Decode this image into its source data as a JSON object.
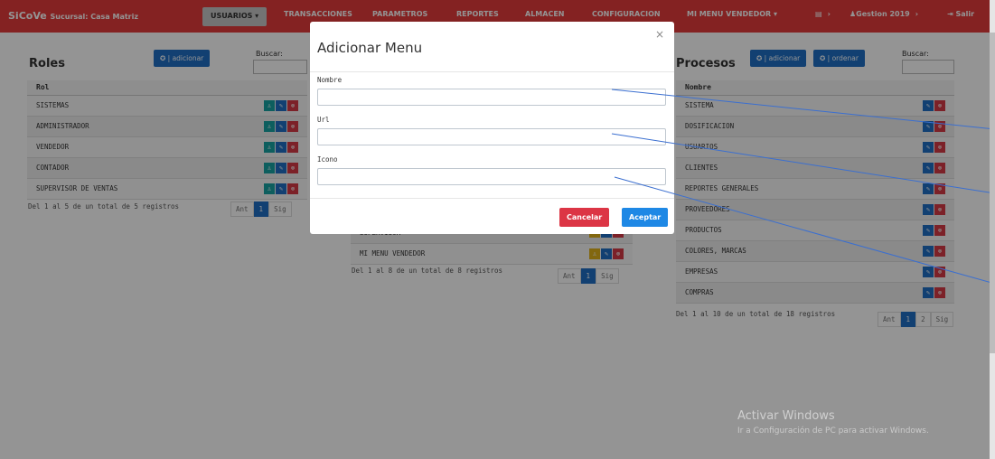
{
  "navbar": {
    "brand": "SiCoVe",
    "branch": "Sucursal: Casa Matriz",
    "items": {
      "usuarios": "USUARIOS ▾",
      "transacciones": "TRANSACCIONES",
      "parametros": "PARAMETROS",
      "reportes": "REPORTES",
      "almacen": "ALMACEN",
      "configuracion": "CONFIGURACION",
      "mi_menu": "MI MENU VENDEDOR ▾",
      "gestion": "♟Gestion 2019",
      "salir": "⇥ Salir"
    }
  },
  "roles": {
    "title": "Roles",
    "add_label": "✪ | adicionar",
    "search_label": "Buscar:",
    "column": "Rol",
    "rows": [
      "SISTEMAS",
      "ADMINISTRADOR",
      "VENDEDOR",
      "CONTADOR",
      "SUPERVISOR DE VENTAS"
    ],
    "footer": "Del 1 al 5 de un total de 5 registros",
    "pager": {
      "prev": "Ant",
      "page": "1",
      "next": "Sig"
    }
  },
  "menus": {
    "rows": [
      "SUPERVISOR",
      "MI MENU VENDEDOR"
    ],
    "footer": "Del 1 al 8 de un total de 8 registros",
    "pager": {
      "prev": "Ant",
      "page": "1",
      "next": "Sig"
    }
  },
  "procesos": {
    "title": "Procesos",
    "add_label": "✪ | adicionar",
    "order_label": "✪ | ordenar",
    "search_label": "Buscar:",
    "column": "Nombre",
    "rows": [
      "SISTEMA",
      "DOSIFICACION",
      "USUARIOS",
      "CLIENTES",
      "REPORTES GENERALES",
      "PROVEEDORES",
      "PRODUCTOS",
      "COLORES, MARCAS",
      "EMPRESAS",
      "COMPRAS"
    ],
    "footer": "Del 1 al 10 de un total de 18 registros",
    "pager": {
      "prev": "Ant",
      "p1": "1",
      "p2": "2",
      "next": "Sig"
    }
  },
  "modal": {
    "title": "Adicionar Menu",
    "close": "×",
    "nombre_label": "Nombre",
    "nombre_value": "",
    "url_label": "Url",
    "url_value": "",
    "icono_label": "Icono",
    "icono_value": "",
    "cancel": "Cancelar",
    "accept": "Aceptar"
  },
  "watermark": {
    "line1": "Activar Windows",
    "line2": "Ir a Configuración de PC para activar Windows."
  },
  "colors": {
    "navbar": "#e33c3c",
    "primary": "#1f6fc4",
    "danger": "#dc3545",
    "teal": "#17a2a2"
  }
}
